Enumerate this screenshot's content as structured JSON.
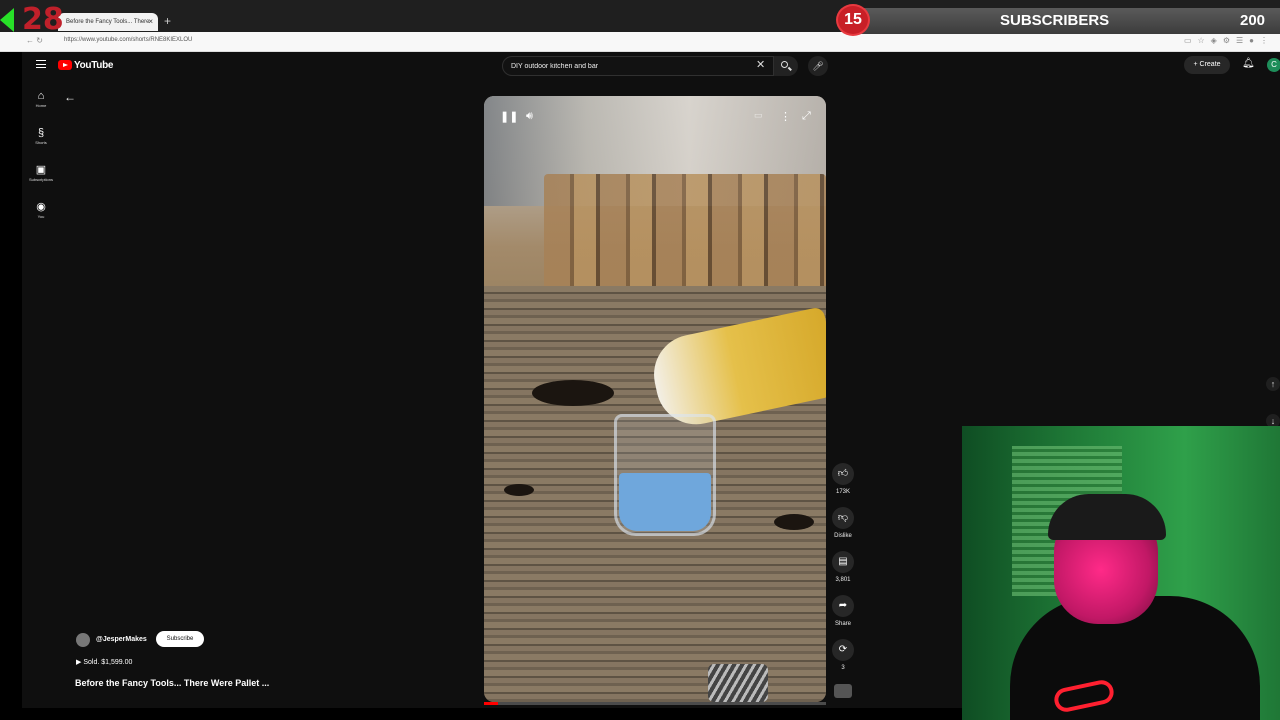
{
  "browser": {
    "tab_title": "Before the Fancy Tools... There",
    "tab_close": "×",
    "new_tab": "+",
    "url": "https://www.youtube.com/shorts/RNE8KIEXLOU"
  },
  "overlay": {
    "left_counter": "28",
    "subs_current": "15",
    "subs_label": "SUBSCRIBERS",
    "subs_goal": "200"
  },
  "youtube": {
    "wordmark": "YouTube",
    "search_value": "DIY outdoor kitchen and bar",
    "create_label": "Create",
    "avatar_letter": "C",
    "rail": [
      {
        "icon": "⌂",
        "label": "Home"
      },
      {
        "icon": "§",
        "label": "Shorts"
      },
      {
        "icon": "▣",
        "label": "Subscriptions"
      },
      {
        "icon": "◉",
        "label": "You"
      }
    ]
  },
  "short": {
    "likes": "173K",
    "dislike_label": "Dislike",
    "comments": "3,801",
    "share_label": "Share",
    "remix_count": "3",
    "channel": "@JesperMakes",
    "subscribe_label": "Subscribe",
    "sold_text": "▶ Sold. $1,599.00",
    "title": "Before the Fancy Tools... There Were Pallet ...",
    "progress_fraction": 0.04
  },
  "colors": {
    "accent": "#ff0000",
    "subs_badge": "#c81f27",
    "webcam_green": "#2fa04a"
  }
}
